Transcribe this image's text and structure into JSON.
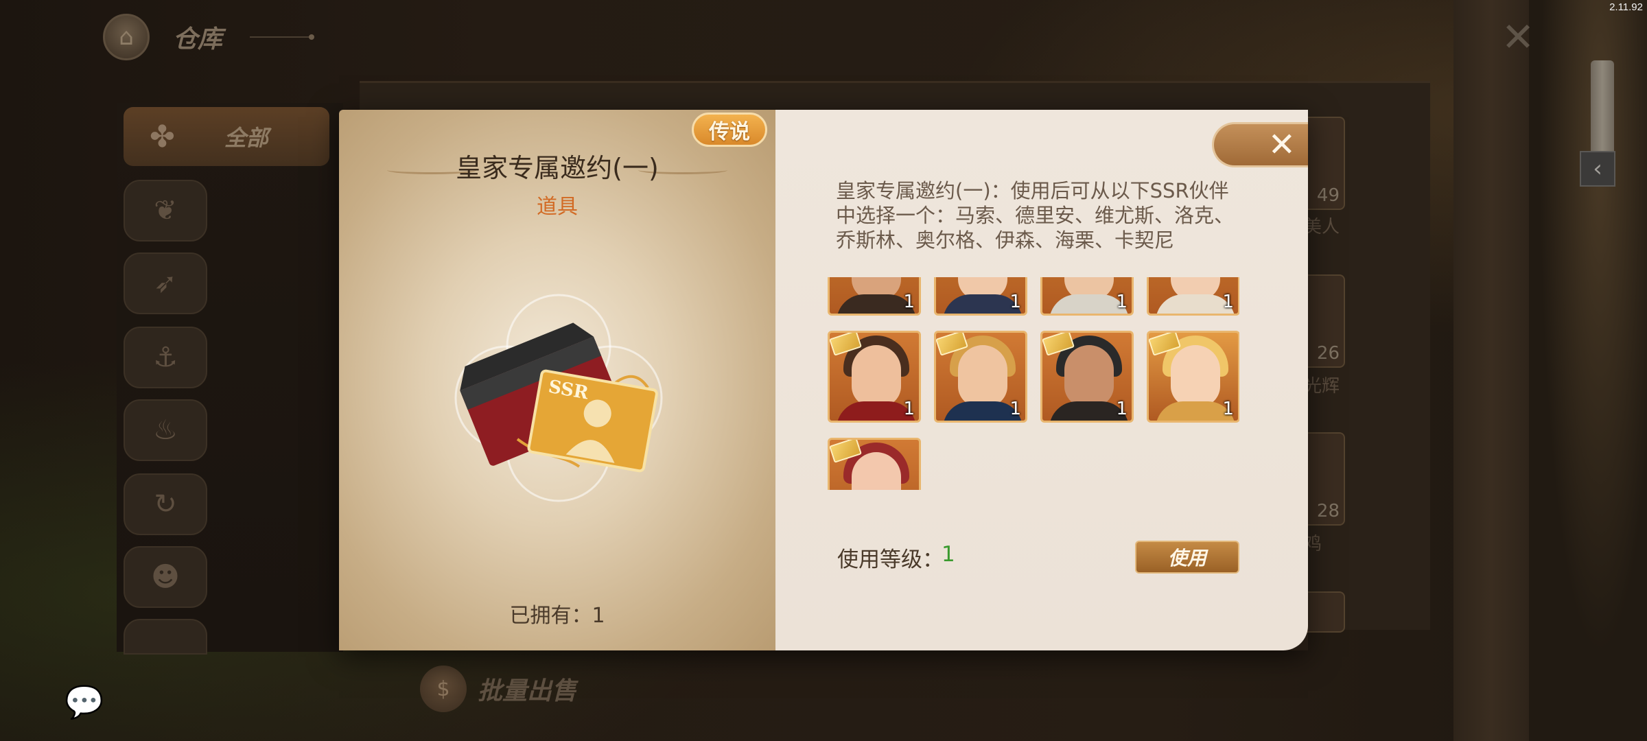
{
  "app": {
    "version": "2.11.92",
    "page_title": "仓库",
    "home_icon": "home-icon",
    "close_icon": "close-icon"
  },
  "sidebar": {
    "all_label": "全部",
    "categories": [
      {
        "icon": "wheat-icon"
      },
      {
        "icon": "bow-icon"
      },
      {
        "icon": "harpoon-icon"
      },
      {
        "icon": "pot-icon"
      },
      {
        "icon": "cycle-icon"
      },
      {
        "icon": "portrait-icon"
      },
      {
        "icon": "badge-icon"
      }
    ]
  },
  "background_items": [
    {
      "count": "49",
      "label": "美人"
    },
    {
      "count": "26",
      "label": "光辉"
    },
    {
      "count": "28",
      "label": "鸡"
    }
  ],
  "bulk_sell_label": "批量出售",
  "modal": {
    "rarity_badge": "传说",
    "item_name": "皇家专属邀约(一)",
    "item_type": "道具",
    "owned_label": "已拥有：",
    "owned_count": "1",
    "description": "皇家专属邀约(一)：使用后可从以下SSR伙伴中选择一个：马索、德里安、维尤斯、洛克、乔斯林、奥尔格、伊森、海栗、卡契尼",
    "card_label": "SSR",
    "portraits": [
      {
        "qty": "1",
        "has_ticket": false,
        "skin": "#d9a37c",
        "hair": "#2b1d14",
        "body": "#3a2a20",
        "bg": "#c8782e"
      },
      {
        "qty": "1",
        "has_ticket": false,
        "skin": "#f0c8a8",
        "hair": "#c99a55",
        "body": "#2c3550",
        "bg": "#c8782e"
      },
      {
        "qty": "1",
        "has_ticket": false,
        "skin": "#ecc4a2",
        "hair": "#e9e6df",
        "body": "#d8d3c8",
        "bg": "#c8782e"
      },
      {
        "qty": "1",
        "has_ticket": false,
        "skin": "#f2cdb0",
        "hair": "#6b4a2e",
        "body": "#e8ddcc",
        "bg": "#c8782e"
      },
      {
        "qty": "1",
        "has_ticket": true,
        "skin": "#eebf9c",
        "hair": "#4a2e1e",
        "body": "#8e1c1c",
        "bg": "#d17a34"
      },
      {
        "qty": "1",
        "has_ticket": true,
        "skin": "#efc4a0",
        "hair": "#d7a04a",
        "body": "#1e3150",
        "bg": "#d17a34"
      },
      {
        "qty": "1",
        "has_ticket": true,
        "skin": "#c98f6a",
        "hair": "#2a2a2a",
        "body": "#2a2522",
        "bg": "#d17a34"
      },
      {
        "qty": "1",
        "has_ticket": true,
        "skin": "#f6d2b4",
        "hair": "#f0c668",
        "body": "#d9a048",
        "bg": "#e39a44"
      },
      {
        "qty": "",
        "has_ticket": true,
        "skin": "#f3c8ad",
        "hair": "#9a2a2a",
        "body": "#8a2222",
        "bg": "#d17a34"
      }
    ],
    "use_level_label": "使用等级：",
    "use_level_value": "1",
    "use_button": "使用"
  },
  "chat_icon": "chat-icon",
  "colors": {
    "accent_gold": "#d9892b",
    "type_orange": "#d26a24",
    "level_green": "#3a9a2e"
  }
}
